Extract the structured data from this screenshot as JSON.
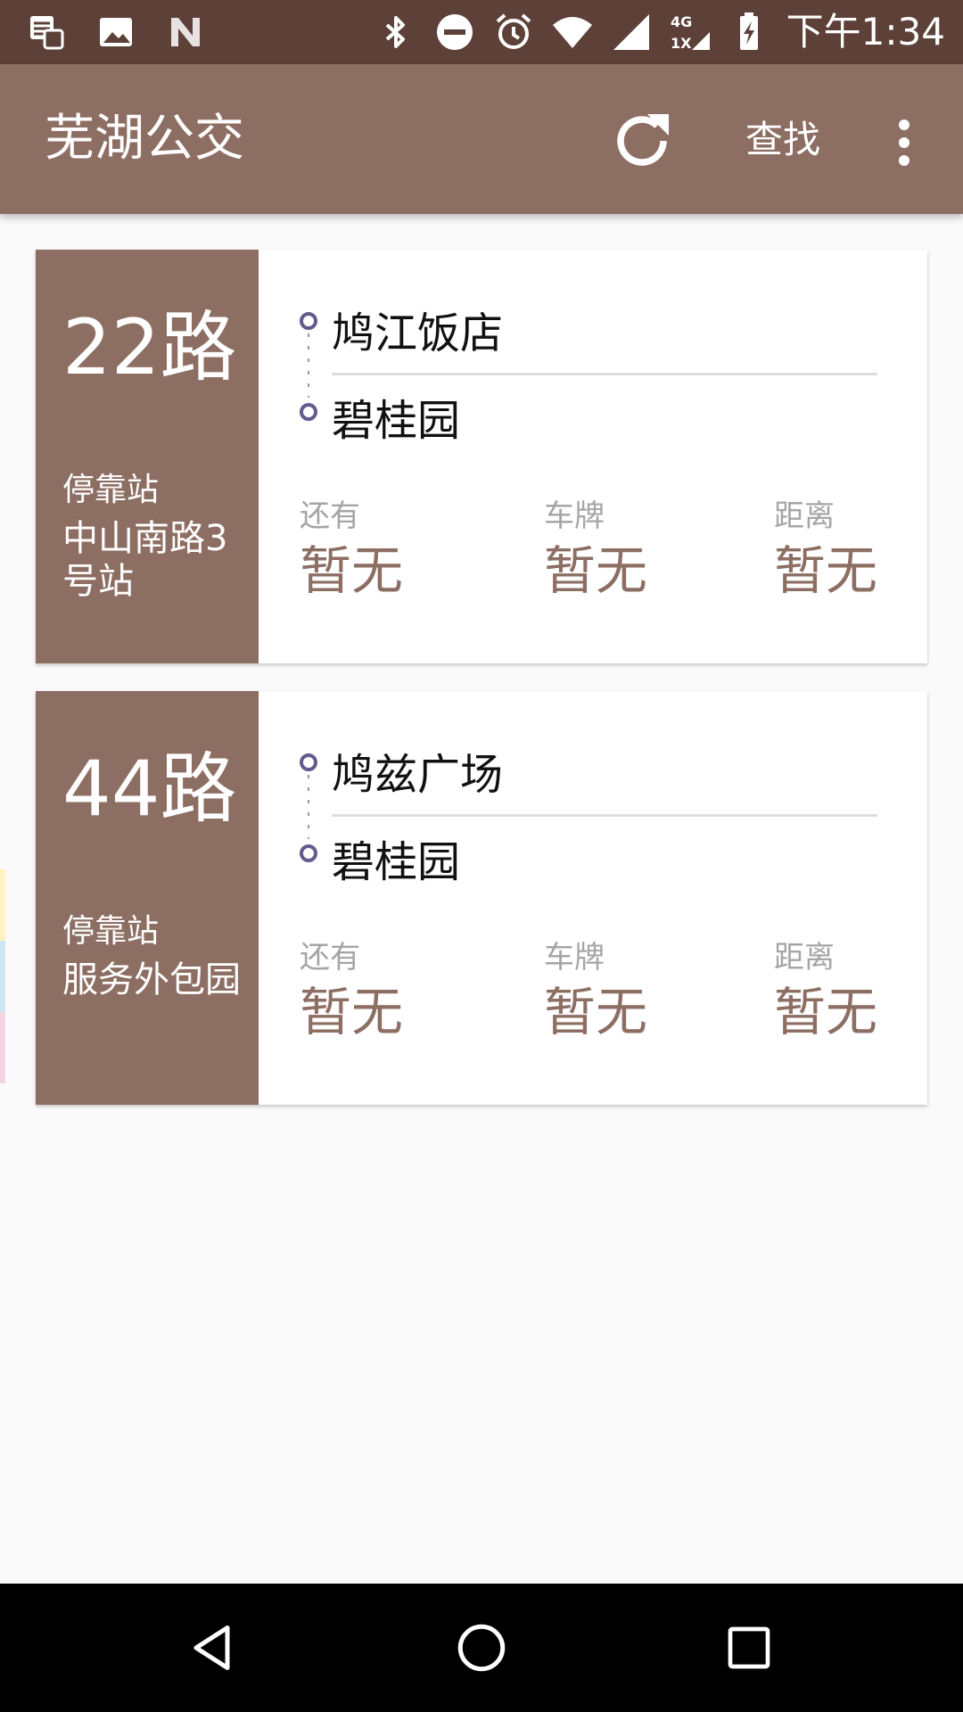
{
  "status_bar": {
    "time": "下午1:34",
    "network_label_top": "4G",
    "network_label_bottom": "1X",
    "icons": [
      "notification-stack-icon",
      "image-icon",
      "n-app-icon",
      "bluetooth-icon",
      "do-not-disturb-icon",
      "alarm-icon",
      "wifi-icon",
      "cell-signal-icon",
      "battery-charging-icon"
    ]
  },
  "app_bar": {
    "title": "芜湖公交",
    "search_label": "查找",
    "refresh_icon": "refresh-icon",
    "more_icon": "more-vert-icon"
  },
  "cards": [
    {
      "route": "22路",
      "stop_caption": "停靠站",
      "stop_name": "中山南路3号站",
      "from_stop": "鸠江饭店",
      "to_stop": "碧桂园",
      "info": [
        {
          "label": "还有",
          "value": "暂无"
        },
        {
          "label": "车牌",
          "value": "暂无"
        },
        {
          "label": "距离",
          "value": "暂无"
        }
      ]
    },
    {
      "route": "44路",
      "stop_caption": "停靠站",
      "stop_name": "服务外包园",
      "from_stop": "鸠兹广场",
      "to_stop": "碧桂园",
      "info": [
        {
          "label": "还有",
          "value": "暂无"
        },
        {
          "label": "车牌",
          "value": "暂无"
        },
        {
          "label": "距离",
          "value": "暂无"
        }
      ]
    }
  ],
  "colors": {
    "status_bar": "#5d4037",
    "primary": "#8d6e63",
    "route_dot": "#645a8c",
    "label": "#a5a5a5",
    "background": "#fafafa"
  },
  "nav_bar": {
    "icons": [
      "back-icon",
      "home-icon",
      "recents-icon"
    ]
  }
}
